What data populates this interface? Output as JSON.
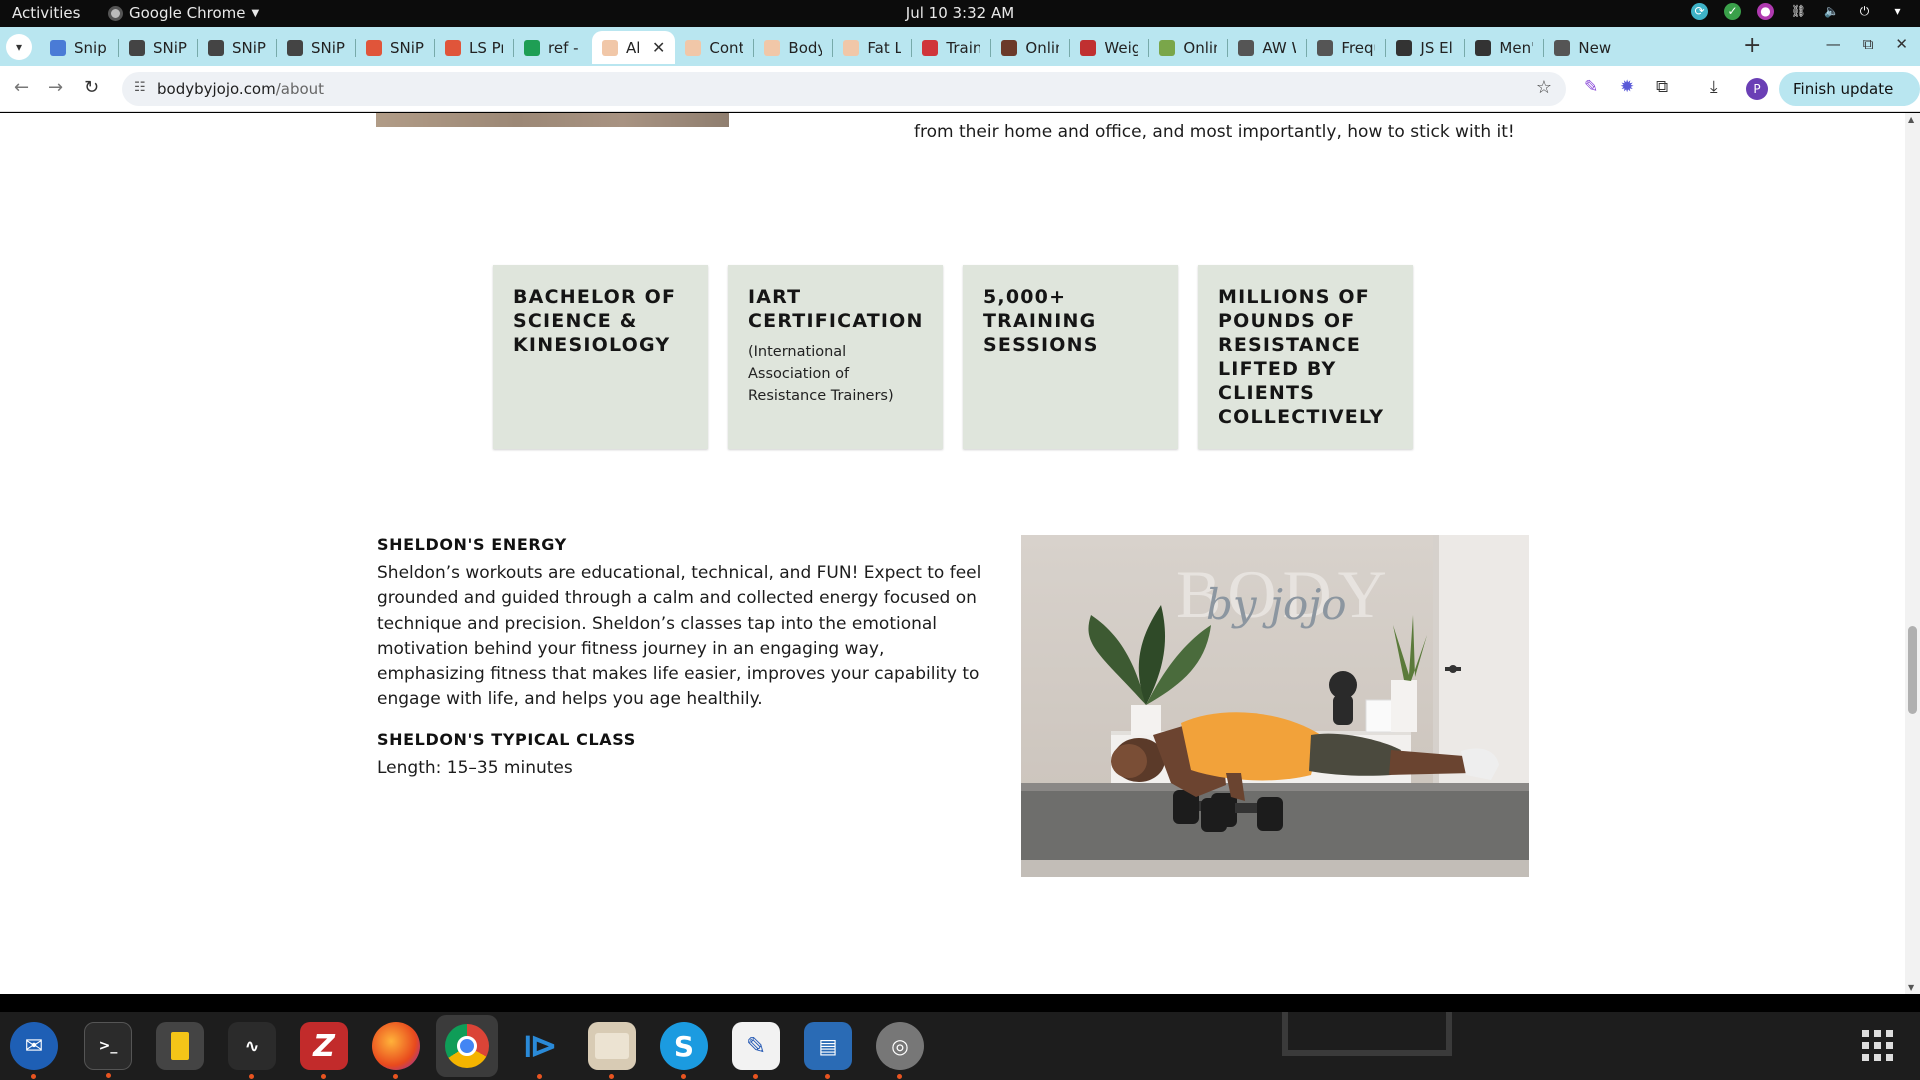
{
  "system_bar": {
    "activities": "Activities",
    "app_name": "Google Chrome",
    "clock": "Jul 10  3:32 AM"
  },
  "browser": {
    "tabs": [
      {
        "label": "Snip D",
        "icon": "docs-icon",
        "color": "#4a7bd6"
      },
      {
        "label": "SNiP",
        "icon": "snip-icon",
        "color": "#444444"
      },
      {
        "label": "SNiP",
        "icon": "snip-icon",
        "color": "#444444"
      },
      {
        "label": "SNiP",
        "icon": "snip-icon",
        "color": "#444444"
      },
      {
        "label": "SNiP",
        "icon": "fruit-icon",
        "color": "#e0553a"
      },
      {
        "label": "LS Pr",
        "icon": "ls-icon",
        "color": "#e0553a"
      },
      {
        "label": "ref - C",
        "icon": "sheets-icon",
        "color": "#1e9e54"
      },
      {
        "label": "Al",
        "icon": "bodybyjojo-icon",
        "color": "#f1c7a8",
        "active": true
      },
      {
        "label": "Conta",
        "icon": "bodybyjojo-icon",
        "color": "#f1c7a8"
      },
      {
        "label": "Body",
        "icon": "bodybyjojo-icon",
        "color": "#f1c7a8"
      },
      {
        "label": "Fat Lo",
        "icon": "bodybyjojo-icon",
        "color": "#f1c7a8"
      },
      {
        "label": "Train",
        "icon": "heart-icon",
        "color": "#d0343a"
      },
      {
        "label": "Onlin",
        "icon": "person-icon",
        "color": "#6b3a2a"
      },
      {
        "label": "Weigl",
        "icon": "person-icon",
        "color": "#c03030"
      },
      {
        "label": "Onlin",
        "icon": "image-icon",
        "color": "#7aa64a"
      },
      {
        "label": "AW W",
        "icon": "chart-icon",
        "color": "#555555"
      },
      {
        "label": "Frequ",
        "icon": "chart-icon",
        "color": "#555555"
      },
      {
        "label": "JS Eli",
        "icon": "shield-icon",
        "color": "#333333"
      },
      {
        "label": "Men's",
        "icon": "shield-icon",
        "color": "#333333"
      },
      {
        "label": "New",
        "icon": "globe-icon",
        "color": "#555555"
      }
    ],
    "url_host": "bodybyjojo.com",
    "url_path": "/about",
    "finish_update_label": "Finish update"
  },
  "page": {
    "intro_tail": "from their home and office, and most importantly, how to stick with it!",
    "stats": [
      {
        "heading": "BACHELOR OF SCIENCE & KINESIOLOGY",
        "sub": ""
      },
      {
        "heading": "IART CERTIFICATION",
        "sub": "(International Association of Resistance Trainers)"
      },
      {
        "heading": "5,000+ TRAINING SESSIONS",
        "sub": ""
      },
      {
        "heading": "MILLIONS OF POUNDS OF RESISTANCE LIFTED BY CLIENTS COLLECTIVELY",
        "sub": ""
      }
    ],
    "energy_title": "SHELDON'S ENERGY",
    "energy_body": "Sheldon’s workouts are educational, technical, and FUN! Expect to feel grounded and guided through a calm and collected energy focused on technique and precision. Sheldon’s classes tap into the emotional motivation behind your fitness journey in an engaging way, emphasizing fitness that makes life easier, improves your capability to engage with life, and helps you age healthily.",
    "class_title": "SHELDON'S TYPICAL CLASS",
    "class_length": "Length: 15–35 minutes",
    "photo_wall_text_1": "BODY",
    "photo_wall_text_2": "by jojo"
  },
  "dock": {
    "apps": [
      "thunderbird-icon",
      "terminal-icon",
      "calculator-icon",
      "system-monitor-icon",
      "filezilla-icon",
      "firefox-icon",
      "chrome-icon",
      "vscode-icon",
      "files-icon",
      "skype-icon",
      "text-editor-icon",
      "document-viewer-icon",
      "disk-icon"
    ]
  }
}
